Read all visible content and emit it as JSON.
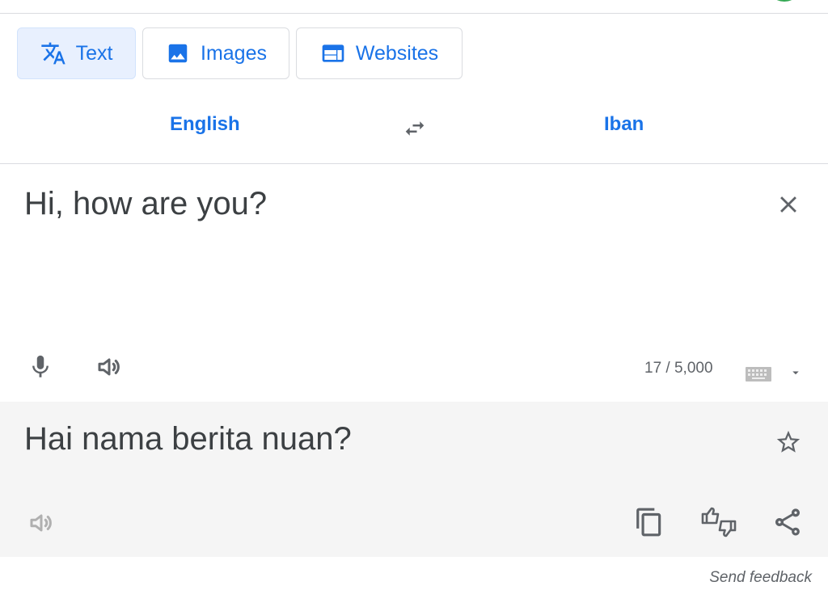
{
  "tabs": [
    {
      "label": "Text",
      "icon": "translate-icon",
      "active": true
    },
    {
      "label": "Images",
      "icon": "image-icon",
      "active": false
    },
    {
      "label": "Websites",
      "icon": "website-icon",
      "active": false
    }
  ],
  "languages": {
    "source": "English",
    "target": "Iban"
  },
  "source": {
    "text": "Hi, how are you?",
    "char_count": "17 / 5,000"
  },
  "output": {
    "text": "Hai nama berita nuan?"
  },
  "footer": {
    "feedback_label": "Send feedback"
  },
  "colors": {
    "accent": "#1a73e8",
    "icon": "#5f6368",
    "panel": "#f5f5f5"
  }
}
